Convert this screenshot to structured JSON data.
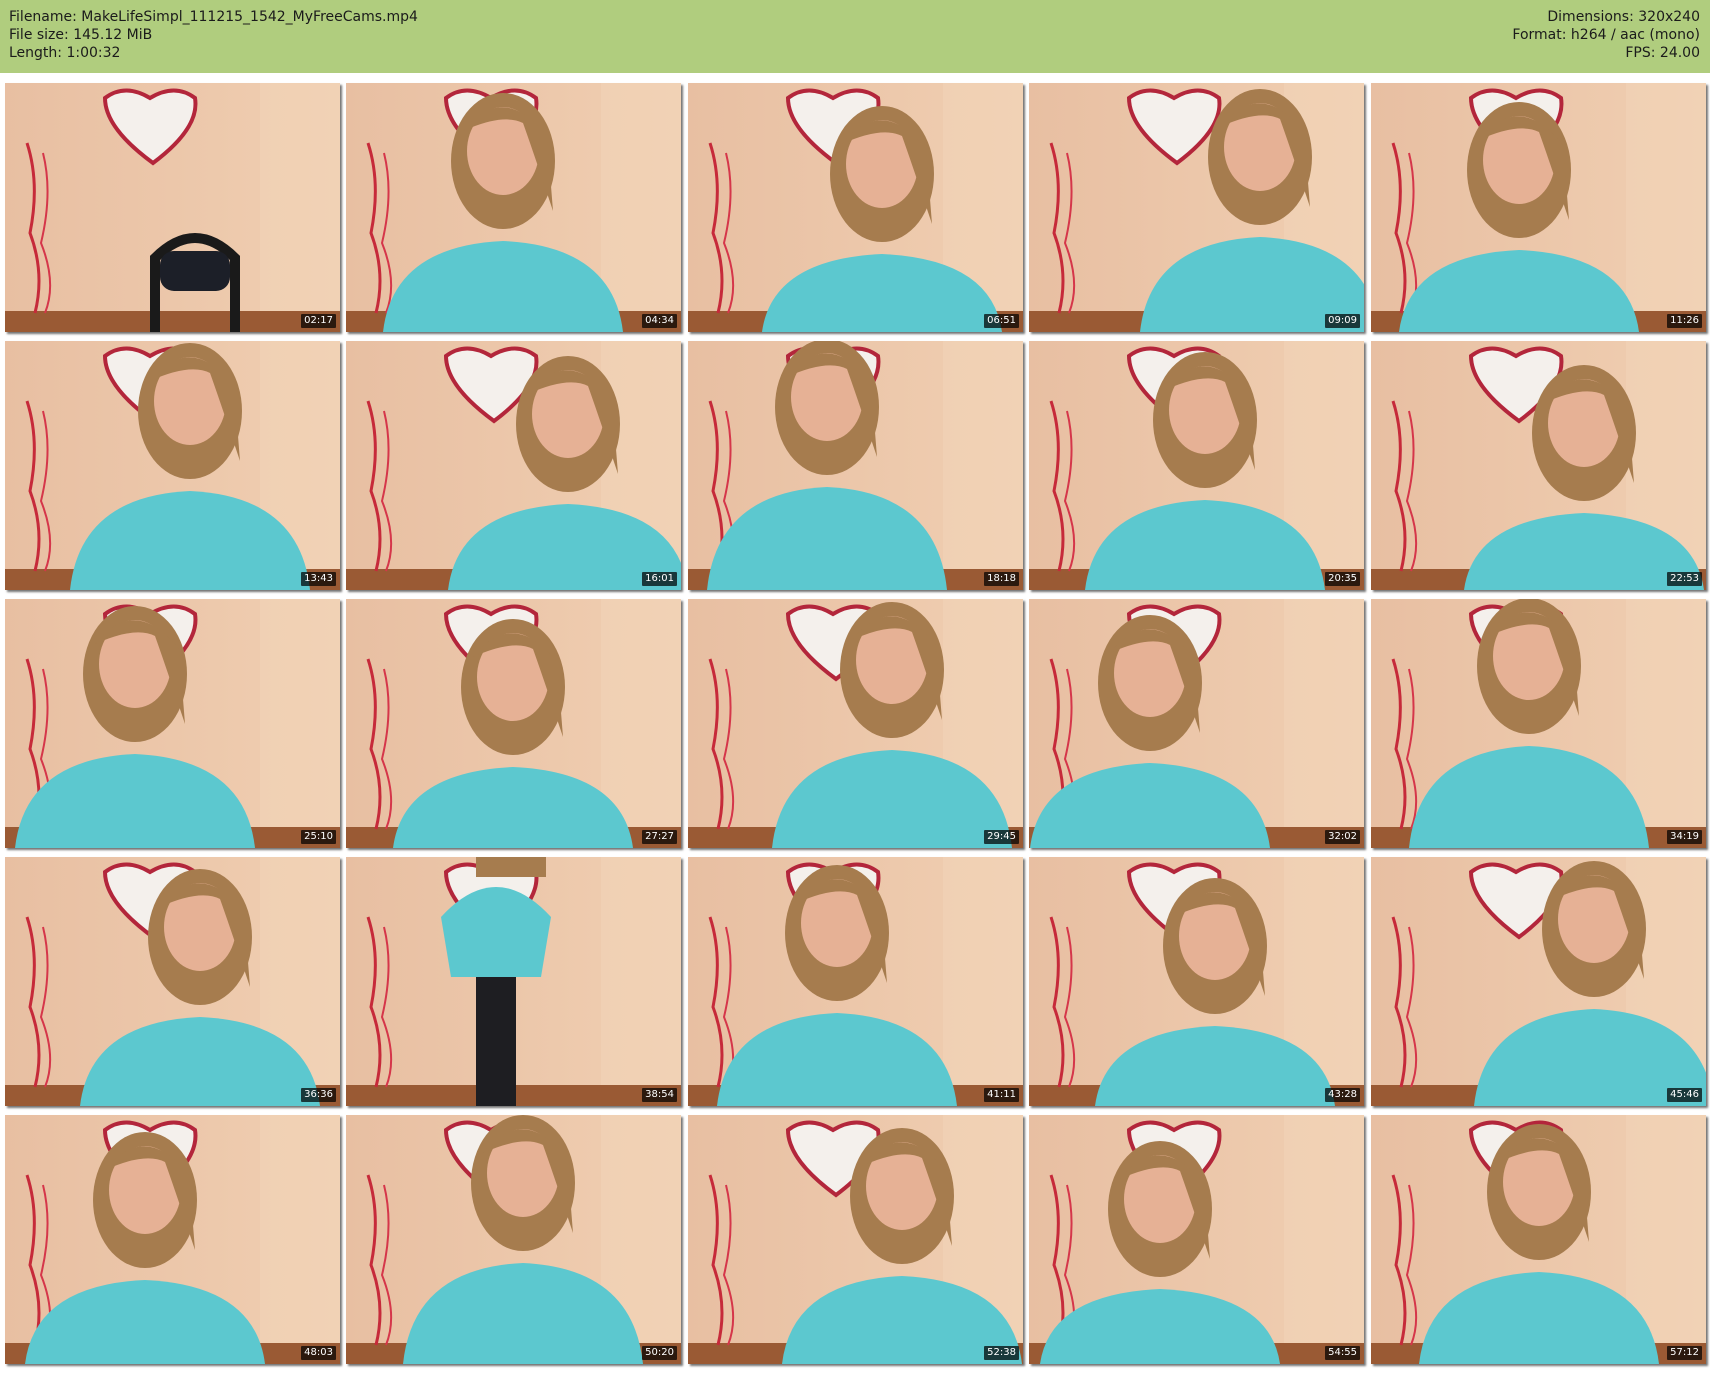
{
  "header": {
    "filename": "Filename: MakeLifeSimpl_111215_1542_MyFreeCams.mp4",
    "filesize": "File size: 145.12 MiB",
    "length": "Length: 1:00:32",
    "dimensions": "Dimensions: 320x240",
    "format": "Format: h264 / aac (mono)",
    "fps": "FPS: 24.00"
  },
  "thumbnails": [
    {
      "time": "02:17"
    },
    {
      "time": "04:34"
    },
    {
      "time": "06:51"
    },
    {
      "time": "09:09"
    },
    {
      "time": "11:26"
    },
    {
      "time": "13:43"
    },
    {
      "time": "16:01"
    },
    {
      "time": "18:18"
    },
    {
      "time": "20:35"
    },
    {
      "time": "22:53"
    },
    {
      "time": "25:10"
    },
    {
      "time": "27:27"
    },
    {
      "time": "29:45"
    },
    {
      "time": "32:02"
    },
    {
      "time": "34:19"
    },
    {
      "time": "36:36"
    },
    {
      "time": "38:54"
    },
    {
      "time": "41:11"
    },
    {
      "time": "43:28"
    },
    {
      "time": "45:46"
    },
    {
      "time": "48:03"
    },
    {
      "time": "50:20"
    },
    {
      "time": "52:38"
    },
    {
      "time": "54:55"
    },
    {
      "time": "57:12"
    }
  ],
  "colors": {
    "header_bg": "#b0cd7e",
    "wall": "#e9c4a6",
    "shirt": "#5cc8cf",
    "hair": "#a67c4e",
    "skin": "#e6b195",
    "floor": "#9a5a34"
  }
}
